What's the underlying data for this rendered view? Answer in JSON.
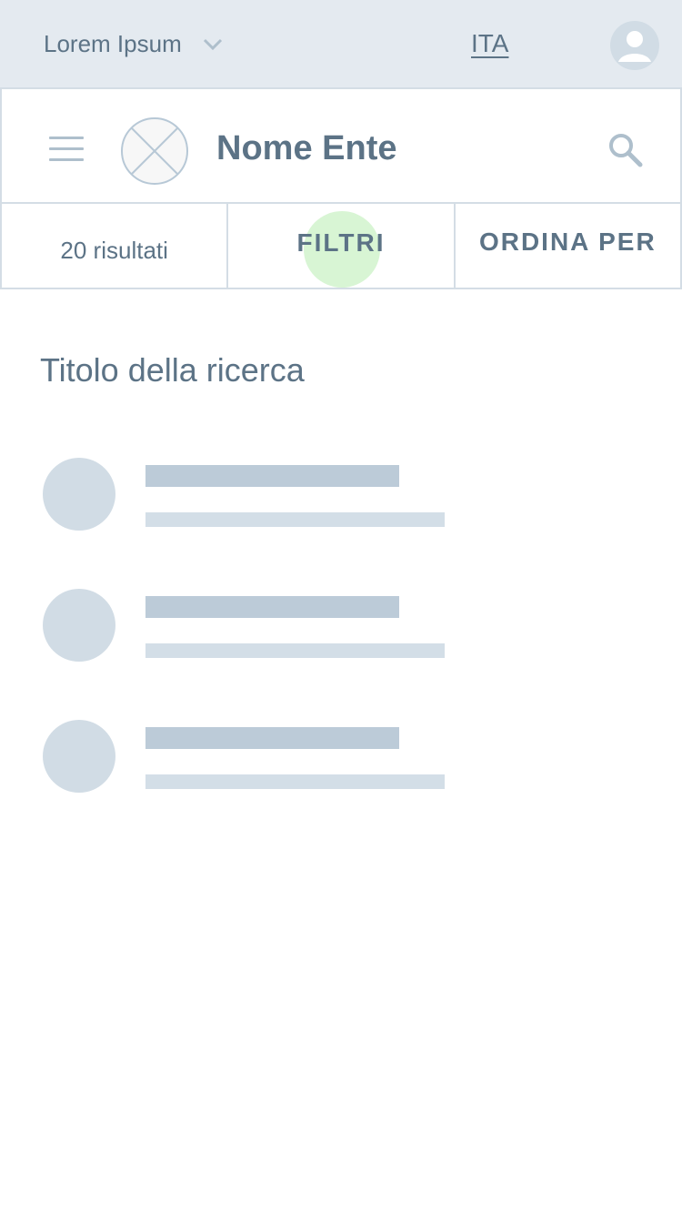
{
  "topbar": {
    "region_label": "Lorem Ipsum",
    "region_icon": "chevron-down-icon",
    "language": "ITA",
    "avatar_icon": "user-icon"
  },
  "header": {
    "menu_icon": "hamburger-menu-icon",
    "logo_icon": "logo-placeholder-icon",
    "title": "Nome Ente",
    "search_icon": "search-icon"
  },
  "toolbar": {
    "results": "20 risultati",
    "filters_label": "FILTRI",
    "sort_label": "ORDINA PER"
  },
  "main": {
    "title": "Titolo della ricerca",
    "items": [
      {
        "type": "skeleton"
      },
      {
        "type": "skeleton"
      },
      {
        "type": "skeleton"
      }
    ]
  },
  "colors": {
    "topbar_bg": "#e4eaf0",
    "text": "#5c7386",
    "border": "#d4dde5",
    "skeleton_dark": "#bccbd8",
    "skeleton_light": "#d3dee7",
    "ripple": "#d8f5d4"
  }
}
